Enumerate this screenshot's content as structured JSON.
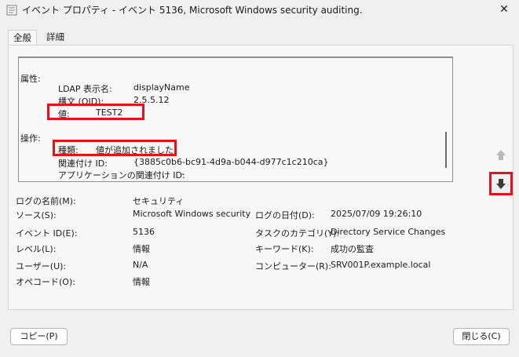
{
  "window": {
    "title": "イベント プロパティ - イベント 5136, Microsoft Windows security auditing.",
    "close_glyph": "✕"
  },
  "tabs": [
    {
      "label": "全般",
      "active": true
    },
    {
      "label": "詳細",
      "active": false
    }
  ],
  "description": {
    "attribute_heading": "属性:",
    "ldap_label": "LDAP 表示名:",
    "ldap_value": "displayName",
    "syntax_label": "構文 (OID):",
    "syntax_value": "2.5.5.12",
    "value_label": "値:",
    "value_value": "TEST2",
    "operation_heading": "操作:",
    "type_label": "種類:",
    "type_value": "値が追加されました",
    "correlation_label": "関連付け ID:",
    "correlation_value": "{3885c0b6-bc91-4d9a-b044-d977c1c210ca}",
    "app_correlation_label": "アプリケーションの関連付け ID:",
    "app_correlation_value": "-"
  },
  "details": {
    "log_name_label": "ログの名前(M):",
    "log_name_value": "セキュリティ",
    "source_label": "ソース(S):",
    "source_value": "Microsoft Windows security a",
    "logged_label": "ログの日付(D):",
    "logged_value": "2025/07/09 19:26:10",
    "event_id_label": "イベント ID(E):",
    "event_id_value": "5136",
    "task_label": "タスクのカテゴリ(Y):",
    "task_value": "Directory Service Changes",
    "level_label": "レベル(L):",
    "level_value": "情報",
    "keywords_label": "キーワード(K):",
    "keywords_value": "成功の監査",
    "user_label": "ユーザー(U):",
    "user_value": "N/A",
    "computer_label": "コンピューター(R):",
    "computer_value": "SRV001P.example.local",
    "opcode_label": "オペコード(O):",
    "opcode_value": "情報"
  },
  "buttons": {
    "copy_label": "コピー(P)",
    "close_label": "閉じる(C)"
  },
  "icons": {
    "window": "event-properties-icon",
    "up": "arrow-up-icon",
    "down": "arrow-down-icon"
  },
  "colors": {
    "highlight": "#e3131e",
    "background": "#f0f0f0"
  }
}
